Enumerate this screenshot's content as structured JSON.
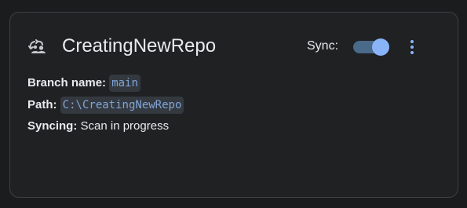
{
  "repo": {
    "name": "CreatingNewRepo",
    "icon": "sync-repo-icon"
  },
  "sync": {
    "label": "Sync:",
    "enabled": true
  },
  "menu": {
    "icon": "more-vertical-icon"
  },
  "details": {
    "branch_label": "Branch name:",
    "branch_value": "main",
    "path_label": "Path:",
    "path_value": "C:\\CreatingNewRepo",
    "syncing_label": "Syncing:",
    "syncing_value": "Scan in progress"
  },
  "colors": {
    "background": "#1b1c1e",
    "card": "#1f2123",
    "text": "#e8eaed",
    "accent": "#8ab4f8",
    "code_text": "#7fa6d8",
    "code_bg": "#34383f"
  }
}
